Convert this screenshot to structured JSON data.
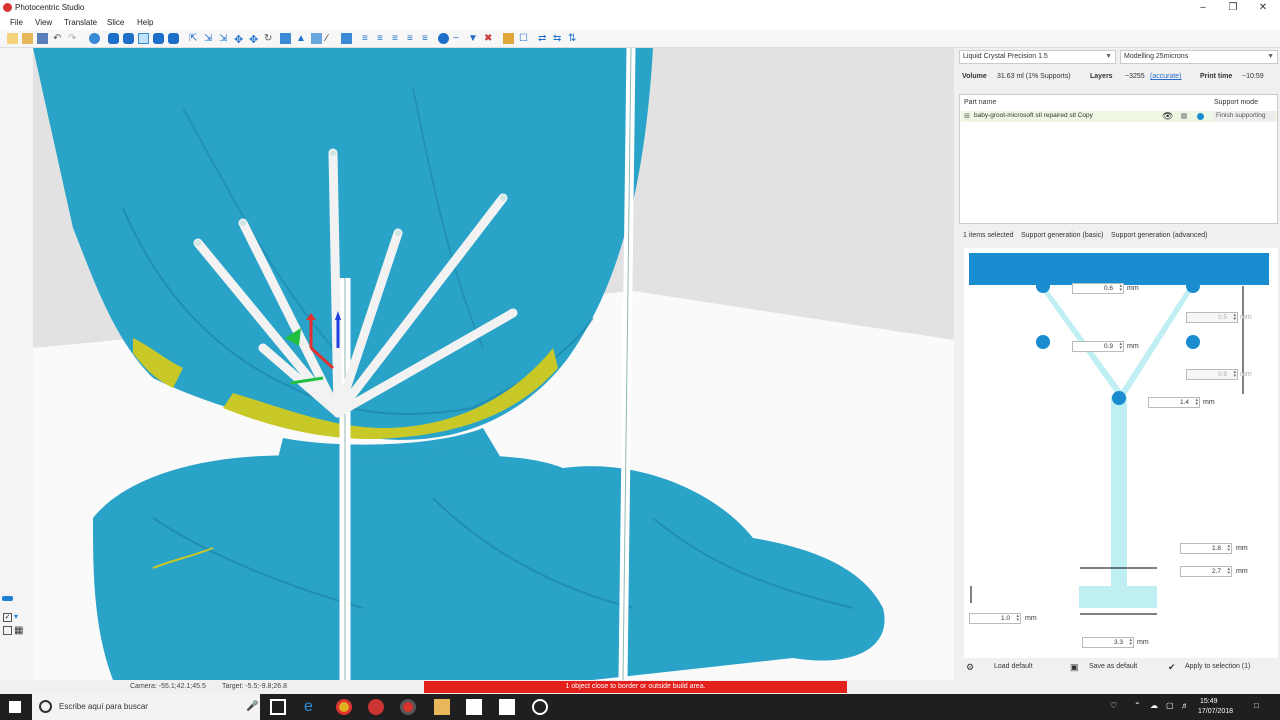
{
  "window": {
    "title": "Photocentric Studio"
  },
  "menu": {
    "file": "File",
    "view": "View",
    "translate": "Translate",
    "slice": "Slice",
    "help": "Help"
  },
  "panel": {
    "printer": "Liquid Crystal Precision 1.5",
    "mode": "Modelling 25microns",
    "volume_label": "Volume",
    "volume_value": "31.63 ml (1% Supports)",
    "layers_label": "Layers",
    "layers_value": "~3255",
    "layers_link": "(accurate)",
    "printtime_label": "Print time",
    "printtime_value": "~10:59",
    "parts": {
      "col_name": "Part name",
      "col_mode": "Support mode",
      "rows": [
        {
          "name": "baby-groot-microsoft stl repaired stl Copy",
          "mode": "Finish supporting"
        }
      ]
    },
    "tabs": {
      "selected": "1 items selected",
      "basic": "Support generation (basic)",
      "advanced": "Support generation (advanced)"
    },
    "params": {
      "p1": "0.6",
      "p2": "0.5",
      "p3": "0.9",
      "p4": "0.9",
      "p5": "1.4",
      "p6": "1.8",
      "p7": "2.7",
      "p8": "1.0",
      "p9": "3.3",
      "unit": "mm"
    },
    "buttons": {
      "load_default": "Load default",
      "save_default": "Save as default",
      "apply": "Apply to selection (1)"
    }
  },
  "status": {
    "camera": "Camera: -55.1;42.1;45.5",
    "target": "Target: -5.5;-9.8;26.8",
    "warning": "1 object close to border or outside build area."
  },
  "taskbar": {
    "search_placeholder": "Escribe aquí para buscar",
    "time": "15:49",
    "date": "17/07/2018"
  },
  "colors": {
    "model": "#2aa3c9",
    "overhang": "#c8c828",
    "platform": "#1a8cd0",
    "warning": "#e3201b",
    "support_diagram": "#bfeef3"
  }
}
